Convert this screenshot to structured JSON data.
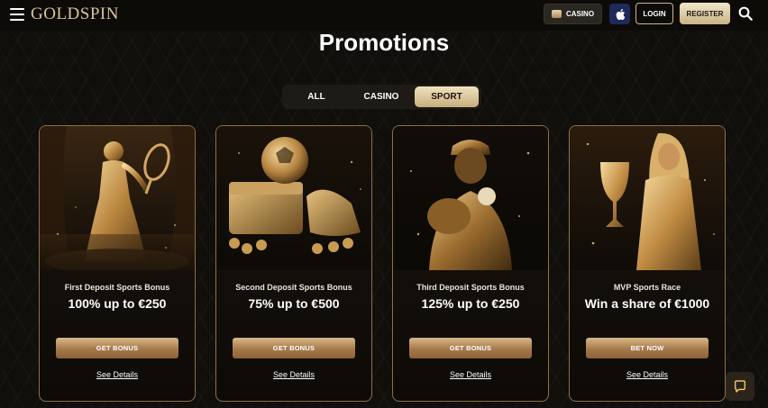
{
  "header": {
    "logo": "GOLDSPIN",
    "casino_label": "CASINO",
    "login_label": "LOGIN",
    "register_label": "REGISTER"
  },
  "page_title": "Promotions",
  "tabs": [
    {
      "label": "ALL",
      "active": false
    },
    {
      "label": "CASINO",
      "active": false
    },
    {
      "label": "SPORT",
      "active": true
    }
  ],
  "cards": [
    {
      "subtitle": "First Deposit Sports Bonus",
      "title": "100% up to €250",
      "button": "GET BONUS",
      "link": "See Details",
      "art": "tennis-player"
    },
    {
      "subtitle": "Second Deposit Sports Bonus",
      "title": "75% up to €500",
      "button": "GET BONUS",
      "link": "See Details",
      "art": "football-treasure"
    },
    {
      "subtitle": "Third Deposit Sports Bonus",
      "title": "125% up to €250",
      "button": "GET BONUS",
      "link": "See Details",
      "art": "baseball-player"
    },
    {
      "subtitle": "MVP Sports Race",
      "title": "Win a share of €1000",
      "button": "BET NOW",
      "link": "See Details",
      "art": "trophy-woman"
    }
  ],
  "colors": {
    "accent_gold": "#c9b385",
    "background": "#110f0c",
    "card_border": "#8a7148"
  },
  "icons": [
    "menu-icon",
    "casino-chip-icon",
    "apple-icon",
    "search-icon",
    "chat-icon"
  ]
}
